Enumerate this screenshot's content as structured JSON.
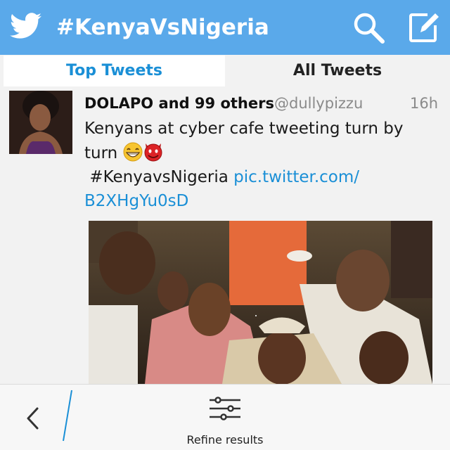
{
  "header": {
    "title": "#KenyaVsNigeria",
    "logo_icon": "twitter-bird-icon",
    "search_icon": "search-icon",
    "compose_icon": "compose-icon",
    "background_color": "#5aa9ea"
  },
  "tabs": {
    "top_label": "Top Tweets",
    "all_label": "All Tweets",
    "active": "Top Tweets",
    "active_color": "#1a8fd6"
  },
  "tweet": {
    "author": "DOLAPO and 99 others",
    "handle": "@dullypizzu",
    "time": "16h",
    "text_line1": "Kenyans at cyber cafe tweeting turn by",
    "text_line2": "turn",
    "emojis": [
      "grinning-face-emoji",
      "smiling-devil-emoji"
    ],
    "hashtag": "#KenyavsNigeria",
    "link_part1": "pic.twitter.com/",
    "link_part2": "B2XHgYu0sD",
    "link_color": "#1a8fd6"
  },
  "bottom_bar": {
    "back_icon": "chevron-left-icon",
    "refine_icon": "sliders-icon",
    "refine_label": "Refine results"
  }
}
